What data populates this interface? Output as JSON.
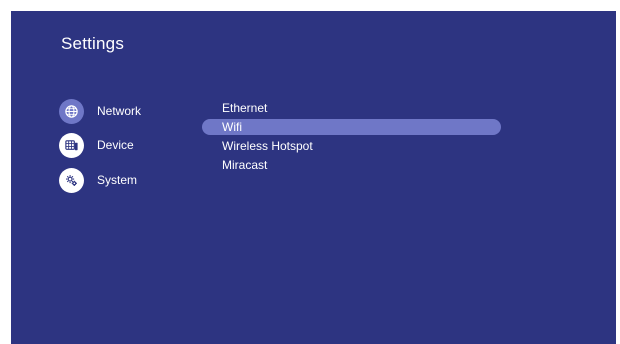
{
  "header": {
    "title": "Settings"
  },
  "categories": [
    {
      "label": "Network",
      "icon": "globe-icon",
      "active": true
    },
    {
      "label": "Device",
      "icon": "device-icon",
      "active": false
    },
    {
      "label": "System",
      "icon": "system-gear-icon",
      "active": false
    }
  ],
  "submenu": [
    {
      "label": "Ethernet",
      "selected": false
    },
    {
      "label": "Wifi",
      "selected": true
    },
    {
      "label": "Wireless Hotspot",
      "selected": false
    },
    {
      "label": "Miracast",
      "selected": false
    }
  ],
  "colors": {
    "background": "#2d3481",
    "highlight": "#6f77c7",
    "text": "#ffffff"
  }
}
